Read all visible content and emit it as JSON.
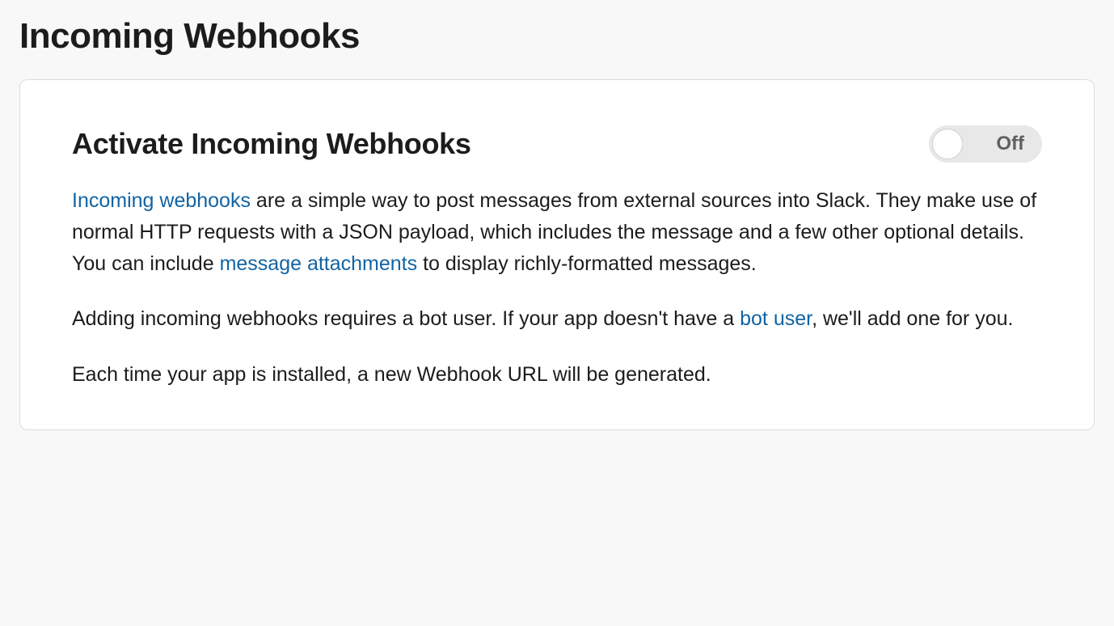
{
  "page": {
    "title": "Incoming Webhooks"
  },
  "section": {
    "title": "Activate Incoming Webhooks",
    "toggle": {
      "state": "off",
      "label": "Off"
    }
  },
  "paragraphs": {
    "p1": {
      "link1": "Incoming webhooks",
      "text1": " are a simple way to post messages from external sources into Slack. They make use of normal HTTP requests with a JSON payload, which includes the message and a few other optional details. You can include ",
      "link2": "message attachments",
      "text2": " to display richly-formatted messages."
    },
    "p2": {
      "text1": "Adding incoming webhooks requires a bot user. If your app doesn't have a ",
      "link1": "bot user",
      "text2": ", we'll add one for you."
    },
    "p3": {
      "text1": "Each time your app is installed, a new Webhook URL will be generated."
    }
  }
}
